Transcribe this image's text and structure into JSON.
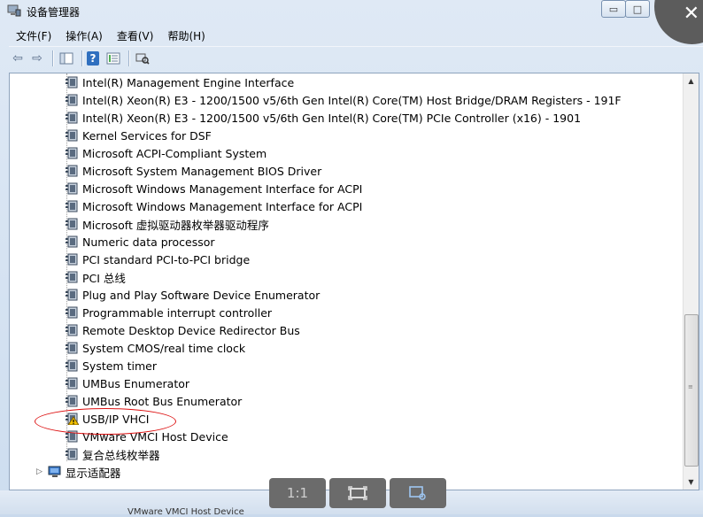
{
  "window": {
    "title": "设备管理器",
    "minimize": "▭",
    "maximize": "□",
    "close": "✕"
  },
  "menu": [
    "文件(F)",
    "操作(A)",
    "查看(V)",
    "帮助(H)"
  ],
  "toolbar": {
    "back": "⇦",
    "forward": "⇨",
    "help": "?"
  },
  "devices": [
    {
      "label": "Intel(R) Management Engine Interface",
      "warning": false
    },
    {
      "label": "Intel(R) Xeon(R) E3 - 1200/1500 v5/6th Gen Intel(R) Core(TM) Host Bridge/DRAM Registers - 191F",
      "warning": false
    },
    {
      "label": "Intel(R) Xeon(R) E3 - 1200/1500 v5/6th Gen Intel(R) Core(TM) PCIe Controller (x16) - 1901",
      "warning": false
    },
    {
      "label": "Kernel Services for DSF",
      "warning": false
    },
    {
      "label": "Microsoft ACPI-Compliant System",
      "warning": false
    },
    {
      "label": "Microsoft System Management BIOS Driver",
      "warning": false
    },
    {
      "label": "Microsoft Windows Management Interface for ACPI",
      "warning": false
    },
    {
      "label": "Microsoft Windows Management Interface for ACPI",
      "warning": false
    },
    {
      "label": "Microsoft 虚拟驱动器枚举器驱动程序",
      "warning": false
    },
    {
      "label": "Numeric data processor",
      "warning": false
    },
    {
      "label": "PCI standard PCI-to-PCI bridge",
      "warning": false
    },
    {
      "label": "PCI 总线",
      "warning": false
    },
    {
      "label": "Plug and Play Software Device Enumerator",
      "warning": false
    },
    {
      "label": "Programmable interrupt controller",
      "warning": false
    },
    {
      "label": "Remote Desktop Device Redirector Bus",
      "warning": false
    },
    {
      "label": "System CMOS/real time clock",
      "warning": false
    },
    {
      "label": "System timer",
      "warning": false
    },
    {
      "label": "UMBus Enumerator",
      "warning": false
    },
    {
      "label": "UMBus Root Bus Enumerator",
      "warning": false
    },
    {
      "label": "USB/IP VHCI",
      "warning": true
    },
    {
      "label": "VMware VMCI Host Device",
      "warning": false
    },
    {
      "label": "复合总线枚举器",
      "warning": false
    }
  ],
  "category": {
    "label": "显示适配器",
    "expander": "▷"
  },
  "viewer": {
    "actual_size": "1:1"
  },
  "status_partial": "VMware VMCI Host Device",
  "colors": {
    "annotation": "#dd1111",
    "warning": "#f2c100"
  }
}
